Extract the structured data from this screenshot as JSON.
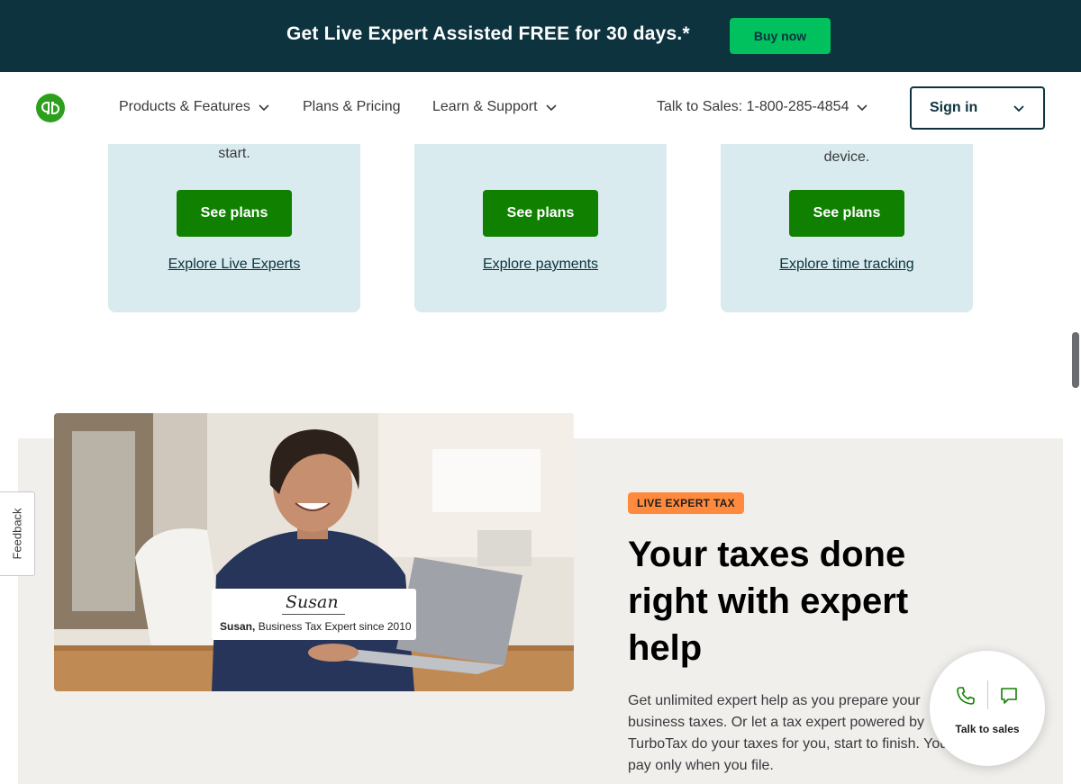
{
  "promo": {
    "text": "Get Live Expert Assisted FREE for 30 days.*",
    "button": "Buy now"
  },
  "header": {
    "logo": "quickbooks-logo",
    "nav": [
      {
        "label": "Products & Features",
        "has_dropdown": true
      },
      {
        "label": "Plans & Pricing",
        "has_dropdown": false
      },
      {
        "label": "Learn & Support",
        "has_dropdown": true
      }
    ],
    "phone": "Talk to Sales: 1-800-285-4854",
    "signin": "Sign in"
  },
  "cards": [
    {
      "tail_text": "start.",
      "button": "See plans",
      "link": "Explore Live Experts"
    },
    {
      "tail_text": "",
      "button": "See plans",
      "link": "Explore payments"
    },
    {
      "tail_text": "device.",
      "button": "See plans",
      "link": "Explore time tracking"
    }
  ],
  "expert": {
    "photo_caption_signature": "Susan",
    "photo_caption_name": "Susan,",
    "photo_caption_role": "Business Tax Expert since 2010",
    "badge": "LIVE EXPERT TAX",
    "heading": "Your taxes done right with expert help",
    "body": "Get unlimited expert help as you prepare your business taxes. Or let a tax expert powered by TurboTax do your taxes for you, start to finish. You pay only when you file."
  },
  "feedback": {
    "label": "Feedback"
  },
  "talk_widget": {
    "label": "Talk to sales"
  },
  "colors": {
    "banner_bg": "#0d333f",
    "accent_green": "#00c15e",
    "button_green": "#108000",
    "card_bg": "#d9ebee",
    "badge_orange": "#ff8a3d",
    "section_bg": "#f0efec"
  }
}
